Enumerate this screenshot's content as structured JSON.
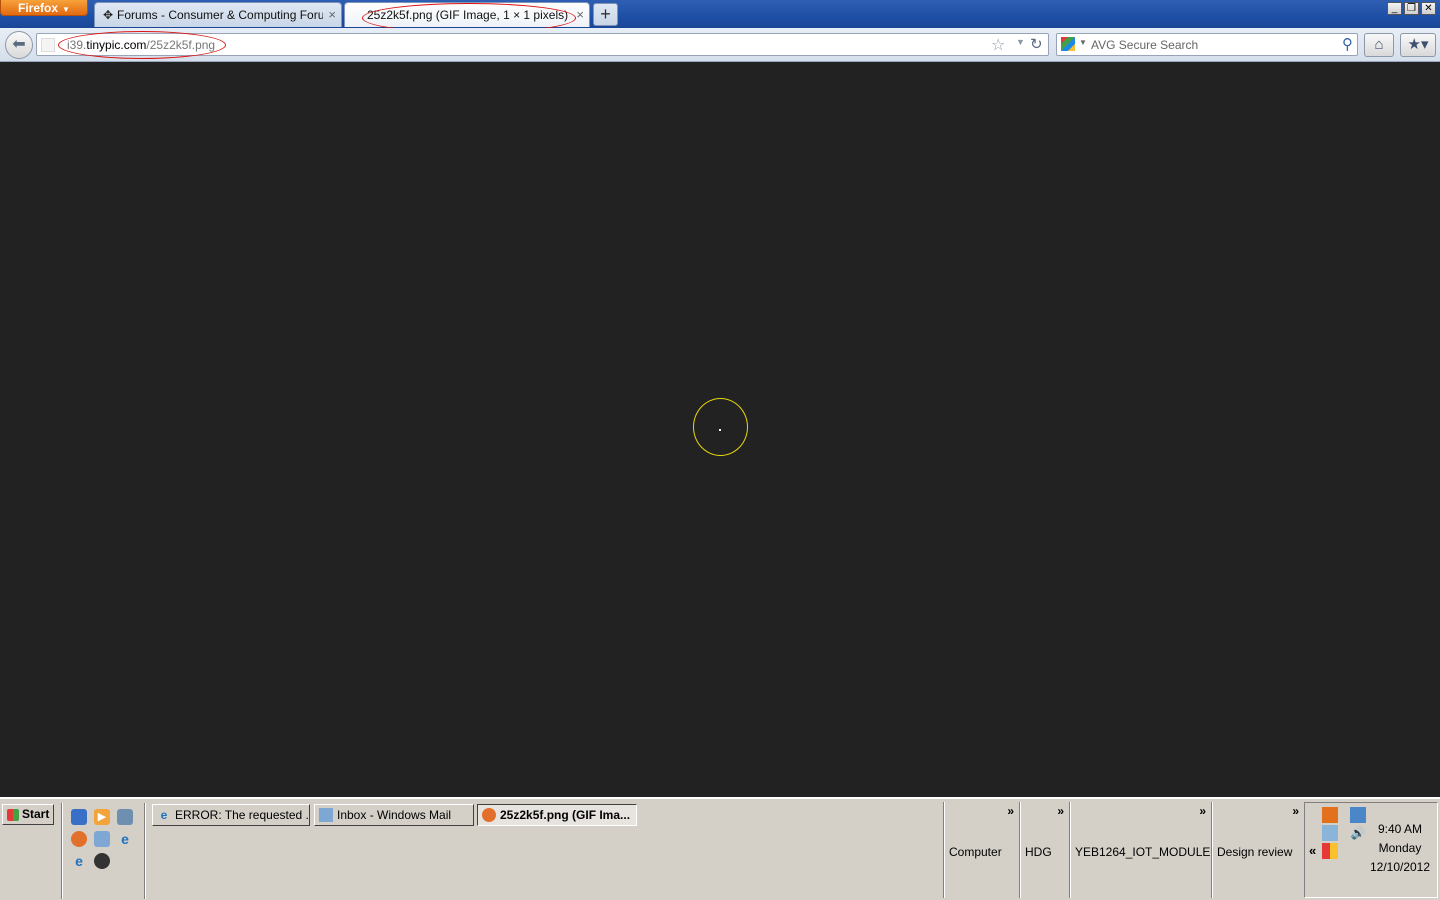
{
  "browser": {
    "menu_label": "Firefox",
    "tabs": [
      {
        "label": "Forums - Consumer & Computing Forum -...",
        "close": "×"
      },
      {
        "label": "25z2k5f.png (GIF Image, 1 × 1 pixels)",
        "close": "×"
      }
    ],
    "new_tab": "+",
    "window_controls": {
      "minimize": "_",
      "restore": "❐",
      "close": "✕"
    }
  },
  "nav": {
    "url_prefix": "i39.",
    "url_domain": "tinypic.com",
    "url_path": "/25z2k5f.png",
    "search_placeholder": "AVG Secure Search"
  },
  "taskbar": {
    "start_label": "Start",
    "tasks": [
      {
        "label": "ERROR: The requested ..."
      },
      {
        "label": "Inbox - Windows Mail"
      },
      {
        "label": "25z2k5f.png (GIF Ima..."
      }
    ],
    "toolbars": [
      {
        "label": "Computer",
        "chevron": "»"
      },
      {
        "label": "HDG",
        "chevron": "»"
      },
      {
        "label": "YEB1264_IOT_MODULE",
        "chevron": "»"
      },
      {
        "label": "Design review",
        "chevron": "»"
      }
    ],
    "tray_back": "«"
  },
  "clock": {
    "time": "9:40 AM",
    "day": "Monday",
    "date": "12/10/2012"
  },
  "colors": {
    "content_bg": "#222222",
    "annotation": "#dd1111",
    "cursor_ring": "#e8d80a",
    "firefox_orange": "#e26a10",
    "taskbar_bg": "#d4d0c8"
  }
}
